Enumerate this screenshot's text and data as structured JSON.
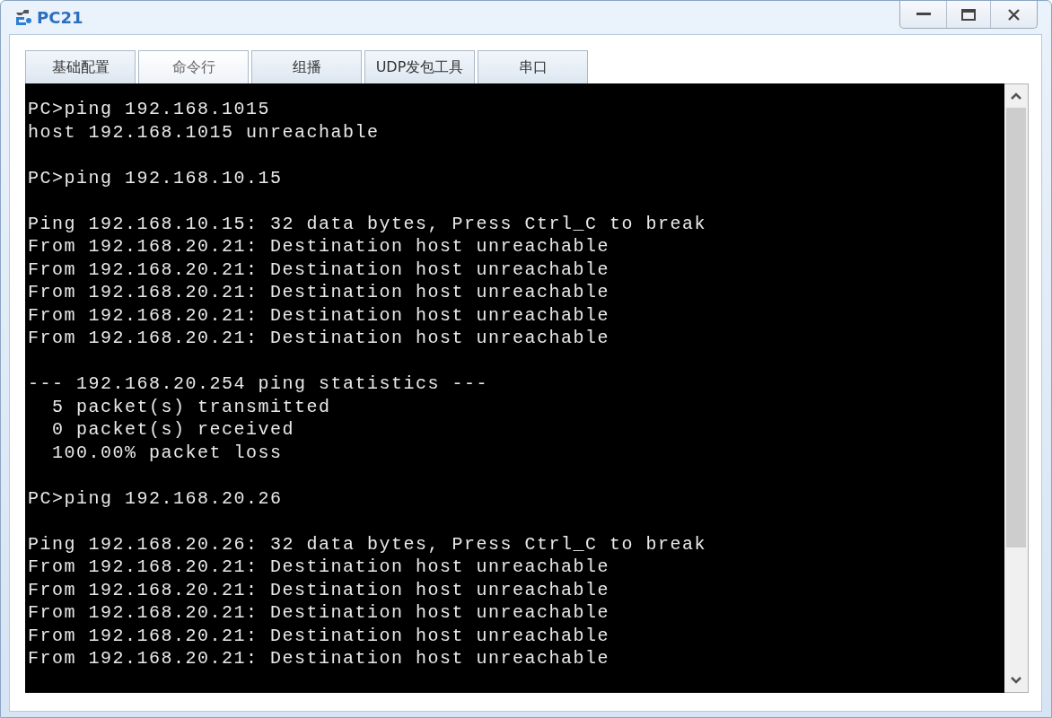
{
  "window": {
    "title": "PC21"
  },
  "tabs": [
    {
      "label": "基础配置",
      "selected": false
    },
    {
      "label": "命令行",
      "selected": true
    },
    {
      "label": "组播",
      "selected": false
    },
    {
      "label": "UDP发包工具",
      "selected": false
    },
    {
      "label": "串口",
      "selected": false
    }
  ],
  "console": {
    "blocks": [
      {
        "lines": [
          "PC>ping 192.168.1015",
          "host 192.168.1015 unreachable"
        ]
      },
      {
        "lines": [
          "PC>ping 192.168.10.15"
        ]
      },
      {
        "lines": [
          "Ping 192.168.10.15: 32 data bytes, Press Ctrl_C to break",
          "From 192.168.20.21: Destination host unreachable",
          "From 192.168.20.21: Destination host unreachable",
          "From 192.168.20.21: Destination host unreachable",
          "From 192.168.20.21: Destination host unreachable",
          "From 192.168.20.21: Destination host unreachable"
        ]
      },
      {
        "lines": [
          "--- 192.168.20.254 ping statistics ---",
          "  5 packet(s) transmitted",
          "  0 packet(s) received",
          "  100.00% packet loss"
        ]
      },
      {
        "lines": [
          "PC>ping 192.168.20.26"
        ]
      },
      {
        "lines": [
          "Ping 192.168.20.26: 32 data bytes, Press Ctrl_C to break",
          "From 192.168.20.21: Destination host unreachable",
          "From 192.168.20.21: Destination host unreachable",
          "From 192.168.20.21: Destination host unreachable",
          "From 192.168.20.21: Destination host unreachable",
          "From 192.168.20.21: Destination host unreachable"
        ]
      }
    ]
  }
}
